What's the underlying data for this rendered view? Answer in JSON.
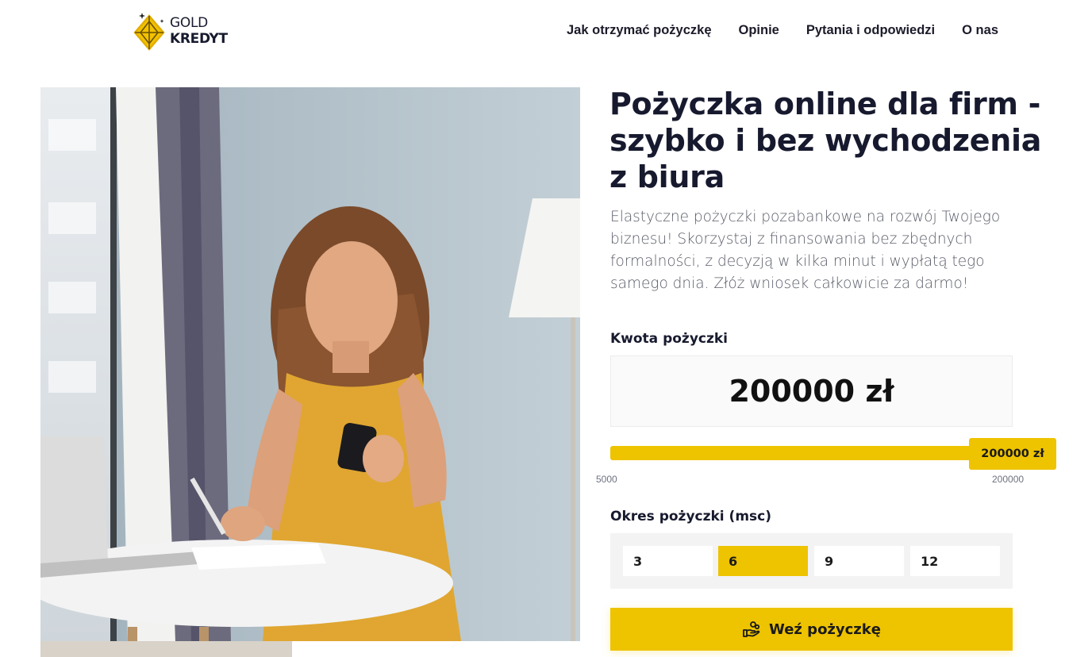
{
  "brand": {
    "line1": "GOLD",
    "line2": "KREDYT"
  },
  "nav": {
    "items": [
      {
        "label": "Jak otrzymać pożyczkę"
      },
      {
        "label": "Opinie"
      },
      {
        "label": "Pytania i odpowiedzi"
      },
      {
        "label": "O nas"
      }
    ]
  },
  "hero": {
    "title": "Pożyczka online dla firm - szybko i bez wychodzenia z biura",
    "description": "Elastyczne pożyczki pozabankowe na rozwój Twojego biznesu! Skorzystaj z finansowania bez zbędnych formalności, z decyzją w kilka minut i wypłatą tego samego dnia. Złóż wniosek całkowicie za darmo!"
  },
  "calculator": {
    "amount_label": "Kwota pożyczki",
    "amount_value": "200000 zł",
    "slider": {
      "handle_label": "200000 zł",
      "min_label": "5000",
      "max_label": "200000",
      "value": 200000,
      "min": 5000,
      "max": 200000
    },
    "period_label": "Okres pożyczki (msc)",
    "periods": [
      {
        "label": "3",
        "active": false
      },
      {
        "label": "6",
        "active": true
      },
      {
        "label": "9",
        "active": false
      },
      {
        "label": "12",
        "active": false
      }
    ],
    "cta_label": "Weź pożyczkę"
  },
  "colors": {
    "accent": "#eec300",
    "text": "#171a2e",
    "muted": "#595d68"
  },
  "icons": {
    "logo": "gold-diamond-icon",
    "cta": "hand-coins-icon"
  }
}
